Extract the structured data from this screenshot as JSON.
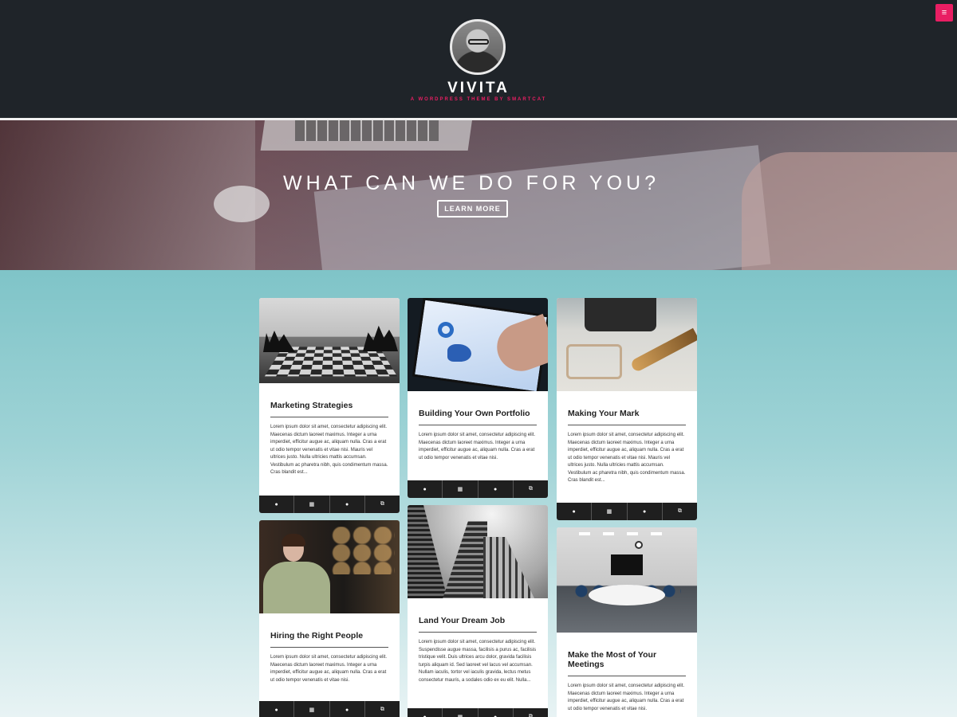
{
  "header": {
    "menu_icon": "≡",
    "site_title": "VIVITA",
    "tagline": "A WORDPRESS THEME BY SMARTCAT"
  },
  "hero": {
    "heading": "WHAT CAN WE DO FOR YOU?",
    "button_label": "LEARN MORE"
  },
  "icons": {
    "author": "●",
    "date": "▦",
    "comments": "●",
    "link": "⧉"
  },
  "posts": [
    {
      "title": "Marketing Strategies",
      "excerpt": "Lorem ipsum dolor sit amet, consectetur adipiscing elit. Maecenas dictum laoreet maximus. Integer a urna imperdiet, efficitur augue ac, aliquam nulla. Cras a erat ut odio tempor venenatis et vitae nisi. Mauris vel ultrices justo. Nulla ultricies mattis accumsan. Vestibulum ac pharetra nibh, quis condimentum massa. Cras blandit est..."
    },
    {
      "title": "Building Your Own Portfolio",
      "excerpt": "Lorem ipsum dolor sit amet, consectetur adipiscing elit. Maecenas dictum laoreet maximus. Integer a urna imperdiet, efficitur augue ac, aliquam nulla. Cras a erat ut odio tempor venenatis et vitae nisi."
    },
    {
      "title": "Making Your Mark",
      "excerpt": "Lorem ipsum dolor sit amet, consectetur adipiscing elit. Maecenas dictum laoreet maximus. Integer a urna imperdiet, efficitur augue ac, aliquam nulla. Cras a erat ut odio tempor venenatis et vitae nisi. Mauris vel ultrices justo. Nulla ultricies mattis accumsan. Vestibulum ac pharetra nibh, quis condimentum massa. Cras blandit est..."
    },
    {
      "title": "Hiring the Right People",
      "excerpt": "Lorem ipsum dolor sit amet, consectetur adipiscing elit. Maecenas dictum laoreet maximus. Integer a urna imperdiet, efficitur augue ac, aliquam nulla. Cras a erat ut odio tempor venenatis et vitae nisi."
    },
    {
      "title": "Land Your Dream Job",
      "excerpt": "Lorem ipsum dolor sit amet, consectetur adipiscing elit. Suspendisse augue massa, facilisis a purus ac, facilisis tristique velit. Duis ultrices arcu dolor, gravida facilisis turpis aliquam id. Sed laoreet vel lacus vel accumsan. Nullam iaculis, tortor vel iaculis gravida, lectus metus consectetur mauris, a sodales odio ex eu elit. Nulla..."
    },
    {
      "title": "Make the Most of Your Meetings",
      "excerpt": "Lorem ipsum dolor sit amet, consectetur adipiscing elit. Maecenas dictum laoreet maximus. Integer a urna imperdiet, efficitur augue ac, aliquam nulla. Cras a erat ut odio tempor venenatis et vitae nisi."
    }
  ]
}
